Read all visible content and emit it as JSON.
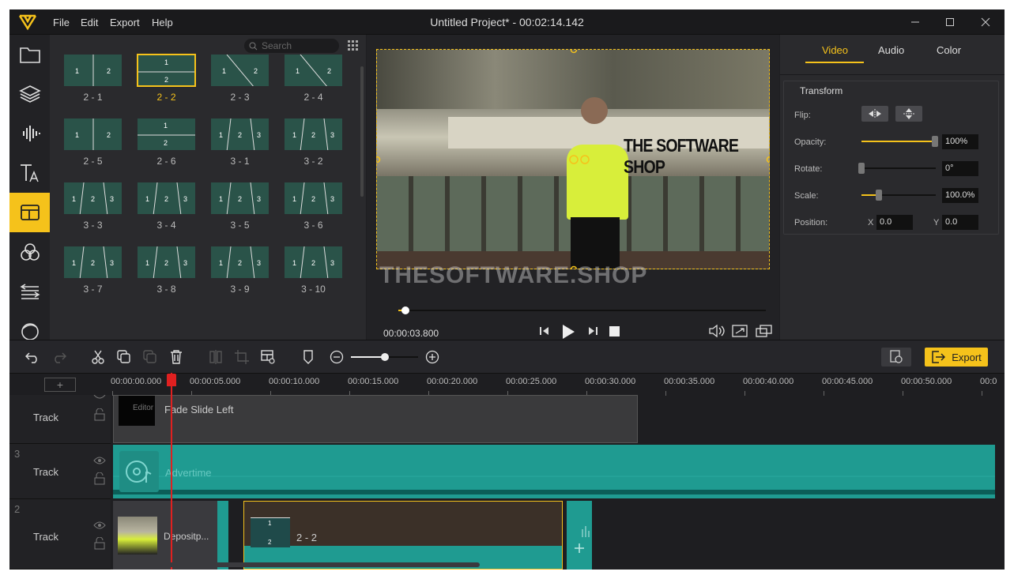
{
  "app": {
    "title": "Untitled Project* - 00:02:14.142",
    "accent": "#f5c21b"
  },
  "menu": [
    "File",
    "Edit",
    "Export",
    "Help"
  ],
  "sidebar": [
    "media-icon",
    "layers-icon",
    "audio-icon",
    "text-icon",
    "transition-icon",
    "effects-icon",
    "filters-icon",
    "sticker-icon"
  ],
  "library": {
    "search_placeholder": "Search",
    "items": [
      {
        "label": "2 - 1",
        "marks": [
          "1",
          "2"
        ]
      },
      {
        "label": "2 - 2",
        "marks": [
          "1",
          "2"
        ],
        "selected": true
      },
      {
        "label": "2 - 3",
        "marks": [
          "1",
          "2"
        ]
      },
      {
        "label": "2 - 4",
        "marks": [
          "1",
          "2"
        ]
      },
      {
        "label": "2 - 5",
        "marks": [
          "1",
          "2"
        ]
      },
      {
        "label": "2 - 6",
        "marks": [
          "1",
          "2"
        ]
      },
      {
        "label": "3 - 1",
        "marks": [
          "1",
          "2",
          "3"
        ]
      },
      {
        "label": "3 - 2",
        "marks": [
          "1",
          "2",
          "3"
        ]
      },
      {
        "label": "3 - 3",
        "marks": [
          "1",
          "2",
          "3"
        ]
      },
      {
        "label": "3 - 4",
        "marks": [
          "1",
          "2",
          "3"
        ]
      },
      {
        "label": "3 - 5",
        "marks": [
          "1",
          "2",
          "3"
        ]
      },
      {
        "label": "3 - 6",
        "marks": [
          "1",
          "2",
          "3"
        ]
      },
      {
        "label": "3 - 7",
        "marks": [
          "1",
          "2",
          "3"
        ]
      },
      {
        "label": "3 - 8",
        "marks": [
          "1",
          "2",
          "3"
        ]
      },
      {
        "label": "3 - 9",
        "marks": [
          "1",
          "2",
          "3"
        ]
      },
      {
        "label": "3 - 10",
        "marks": [
          "1",
          "2",
          "3"
        ]
      }
    ]
  },
  "preview": {
    "overlay_text": "THE SOFTWARE SHOP",
    "watermark": "THESOFTWARE.SHOP",
    "timecode": "00:00:03.800",
    "progress": 0.02
  },
  "props": {
    "tabs": [
      "Video",
      "Audio",
      "Color"
    ],
    "section": "Transform",
    "flip_label": "Flip:",
    "opacity_label": "Opacity:",
    "opacity": "100%",
    "rotate_label": "Rotate:",
    "rotate": "0°",
    "scale_label": "Scale:",
    "scale": "100.0%",
    "position_label": "Position:",
    "x_label": "X",
    "x": "0.0",
    "y_label": "Y",
    "y": "0.0"
  },
  "toolbar": {
    "export": "Export",
    "zoom": 0.5
  },
  "ruler": [
    "00:00:00.000",
    "00:00:05.000",
    "00:00:10.000",
    "00:00:15.000",
    "00:00:20.000",
    "00:00:25.000",
    "00:00:30.000",
    "00:00:35.000",
    "00:00:40.000",
    "00:00:45.000",
    "00:00:50.000",
    "00:0"
  ],
  "tracks": [
    {
      "name": "Track",
      "clip": "Fade Slide Left",
      "thumb_label": "Editor"
    },
    {
      "name": "Track",
      "num": "3",
      "clip": "Advertime"
    },
    {
      "name": "Track",
      "num": "2",
      "clip": "Depositp...",
      "clip2": "2 - 2",
      "thumb_marks": [
        "1",
        "2"
      ]
    }
  ]
}
